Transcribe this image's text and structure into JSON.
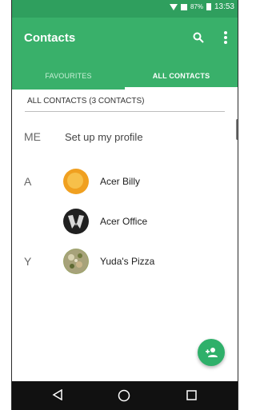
{
  "status_bar": {
    "battery_percent": "87%",
    "time": "13:53",
    "icons": [
      "wifi-icon",
      "signal-icon",
      "battery-icon"
    ]
  },
  "app_bar": {
    "title": "Contacts",
    "icons": [
      "search-icon",
      "overflow-menu-icon"
    ],
    "color": "#39b06a"
  },
  "tabs": [
    {
      "label": "FAVOURITES",
      "selected": false
    },
    {
      "label": "ALL CONTACTS",
      "selected": true
    }
  ],
  "list_header": "ALL CONTACTS (3 CONTACTS)",
  "profile_row": {
    "letter": "ME",
    "label": "Set up my profile"
  },
  "contacts": [
    {
      "letter": "A",
      "name": "Acer Billy"
    },
    {
      "letter": "",
      "name": "Acer Office"
    },
    {
      "letter": "Y",
      "name": "Yuda's Pizza"
    }
  ],
  "fab": {
    "icon": "add-contact-icon",
    "color": "#2fb06a"
  },
  "nav_bar": {
    "icons": [
      "back-icon",
      "home-icon",
      "recent-apps-icon"
    ]
  }
}
